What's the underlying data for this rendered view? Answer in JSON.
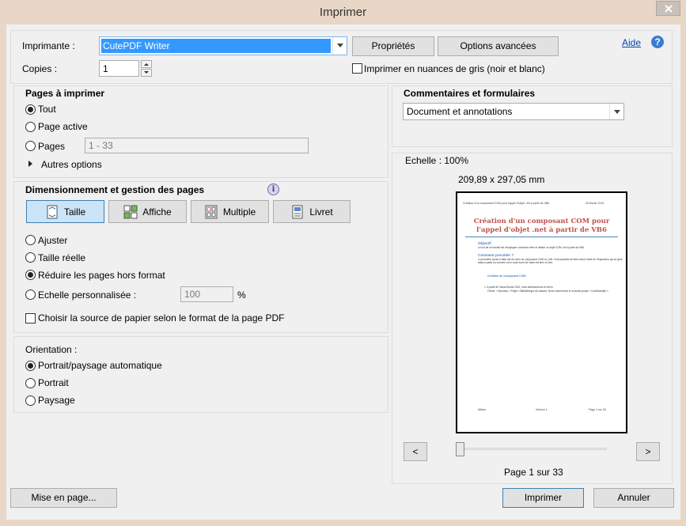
{
  "window": {
    "title": "Imprimer"
  },
  "printer": {
    "label": "Imprimante :",
    "selected": "CutePDF Writer",
    "properties_button": "Propriétés",
    "advanced_button": "Options avancées",
    "help_link": "Aide",
    "copies_label": "Copies :",
    "copies_value": "1",
    "grayscale_label": "Imprimer en nuances de gris (noir et blanc)"
  },
  "pages": {
    "heading": "Pages à imprimer",
    "all_label": "Tout",
    "active_label": "Page active",
    "pages_label": "Pages",
    "pages_value": "1 - 33",
    "more_options_label": "Autres options"
  },
  "comments": {
    "heading": "Commentaires et formulaires",
    "selected": "Document et annotations"
  },
  "sizing": {
    "heading": "Dimensionnement et gestion des pages",
    "buttons": [
      {
        "label": "Taille"
      },
      {
        "label": "Affiche"
      },
      {
        "label": "Multiple"
      },
      {
        "label": "Livret"
      }
    ],
    "fit_label": "Ajuster",
    "actual_label": "Taille réelle",
    "shrink_label": "Réduire les pages hors format",
    "custom_label": "Echelle personnalisée :",
    "custom_value": "100",
    "percent": "%",
    "paper_source_label": "Choisir la source de papier selon le format de la page PDF"
  },
  "orientation": {
    "heading": "Orientation :",
    "auto_label": "Portrait/paysage automatique",
    "portrait_label": "Portrait",
    "landscape_label": "Paysage"
  },
  "preview": {
    "scale": "Echelle : 100%",
    "dimensions": "209,89 x 297,05 mm",
    "page_indicator": "Page 1 sur 33",
    "prev": "<",
    "next": ">",
    "doc": {
      "header_left": "Création d'un composant COM pour l'appel d'objet .net à partir de VB6",
      "header_right": "26 février 2013",
      "title_line1": "Création d'un composant COM pour",
      "title_line2": "l'appel d'objet .net à partir de VB6",
      "section1": "Objectif",
      "section1_text": "Le but de ce tutoriel est d'expliquer comment créer et utiliser un objet COM .net à partir de VB6.",
      "section2": "Comment procéder ?",
      "section2_text": "La première chose à faire est de créer un composant COM en .Net. Il est possible de faire cela à l'aide de l'Inspecteur qui se gère aussi à partir du moment où le code fourni de base est bien à Cela.",
      "bullet1": "Création du composant COM :",
      "step1": "1. A partir de Visual Studio 2010, nous sélectionnons le menu",
      "step1b": "Fichier > Nouveau > Projet > Bibliothèque de classes. Nous nommerons le nouveau projet « ComExample ».",
      "footer_left": "Affaire",
      "footer_center": "Version 1",
      "footer_right": "Page 1 sur 33"
    }
  },
  "footer": {
    "page_setup_button": "Mise en page...",
    "print_button": "Imprimer",
    "cancel_button": "Annuler"
  },
  "colors": {
    "title_bar": "#e8d7c6",
    "selection": "#3399ff",
    "doc_title": "#c0504d",
    "doc_heading": "#4f81bd"
  }
}
